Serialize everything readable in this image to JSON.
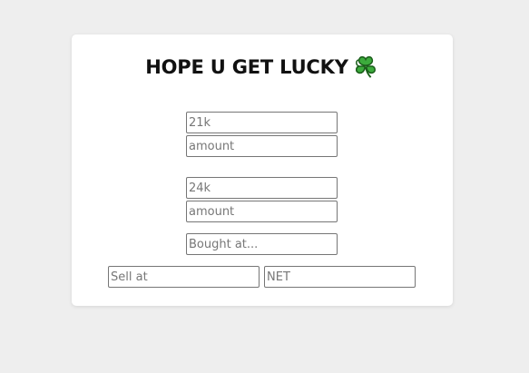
{
  "title": {
    "text": "HOPE U GET LUCKY",
    "icon": "shamrock-icon"
  },
  "fields": {
    "item1_price": {
      "placeholder": "21k",
      "value": ""
    },
    "item1_amount": {
      "placeholder": "amount",
      "value": ""
    },
    "item2_price": {
      "placeholder": "24k",
      "value": ""
    },
    "item2_amount": {
      "placeholder": "amount",
      "value": ""
    },
    "bought_at": {
      "placeholder": "Bought at...",
      "value": ""
    },
    "sell_at": {
      "placeholder": "Sell at",
      "value": ""
    },
    "net": {
      "placeholder": "NET",
      "value": ""
    }
  },
  "colors": {
    "background": "#eeeeee",
    "card": "#ffffff",
    "title_text": "#111111",
    "clover_green": "#3cab3c",
    "clover_outline": "#1a5e1a"
  }
}
